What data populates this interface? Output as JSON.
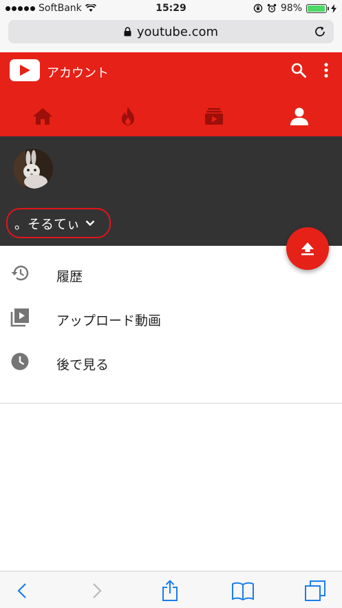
{
  "status_bar": {
    "carrier": "SoftBank",
    "time": "15:29",
    "battery_percent": "98%",
    "battery_level": 0.98
  },
  "browser": {
    "url": "youtube.com"
  },
  "header": {
    "title": "アカウント",
    "accent_color": "#e62117",
    "tabs": [
      {
        "icon": "home-icon"
      },
      {
        "icon": "trending-icon"
      },
      {
        "icon": "subscriptions-icon"
      },
      {
        "icon": "account-icon",
        "active": true
      }
    ]
  },
  "profile": {
    "account_name": "。そるてぃ"
  },
  "menu": {
    "items": [
      {
        "label": "履歴",
        "icon": "history-icon"
      },
      {
        "label": "アップロード動画",
        "icon": "uploads-icon"
      },
      {
        "label": "後で見る",
        "icon": "watch-later-icon"
      }
    ]
  },
  "toolbar": {
    "items": [
      "back-icon",
      "forward-icon",
      "share-icon",
      "bookmarks-icon",
      "tabs-icon"
    ]
  }
}
